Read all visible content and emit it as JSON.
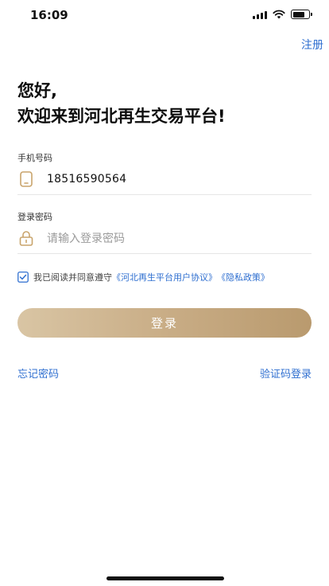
{
  "status_bar": {
    "time": "16:09",
    "battery_level_percent": 75
  },
  "header": {
    "register_label": "注册"
  },
  "greeting": {
    "line1": "您好,",
    "line2": "欢迎来到河北再生交易平台!"
  },
  "phone": {
    "label": "手机号码",
    "value": "18516590564",
    "icon": "phone-icon"
  },
  "password": {
    "label": "登录密码",
    "placeholder": "请输入登录密码",
    "icon": "lock-icon"
  },
  "agreement": {
    "checked": true,
    "text": "我已阅读并同意遵守",
    "link1": "《河北再生平台用户协议》",
    "link2": "《隐私政策》"
  },
  "login": {
    "label": "登录"
  },
  "links": {
    "forgot_password": "忘记密码",
    "sms_login": "验证码登录"
  },
  "colors": {
    "accent": "#2f6fd0",
    "gold_start": "#d9c5a4",
    "gold_end": "#b99a6e",
    "icon_gold": "#c9a46c"
  }
}
